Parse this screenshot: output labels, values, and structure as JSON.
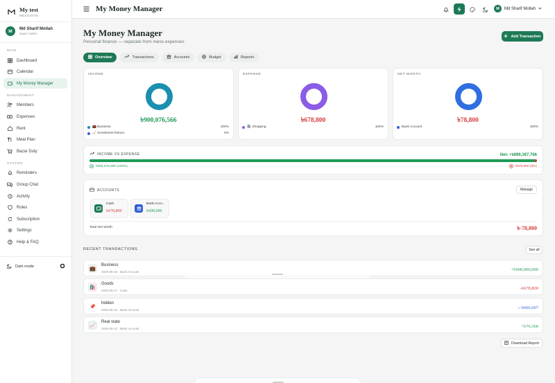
{
  "brand": {
    "name": "My test",
    "subtitle": "MESONATE"
  },
  "user": {
    "initial": "M",
    "name": "Md Sharif Mollah",
    "role": "Super Admin"
  },
  "sidebar": {
    "sections": [
      {
        "label": "MAIN",
        "items": [
          {
            "label": "Dashboard",
            "icon": "grid-icon"
          },
          {
            "label": "Calendar",
            "icon": "calendar-icon"
          },
          {
            "label": "My Money Manager",
            "icon": "wallet-icon",
            "active": true
          }
        ]
      },
      {
        "label": "MANAGEMENT",
        "items": [
          {
            "label": "Members",
            "icon": "users-icon"
          },
          {
            "label": "Expenses",
            "icon": "banknote-icon"
          },
          {
            "label": "Rent",
            "icon": "home-icon"
          },
          {
            "label": "Meal Plan",
            "icon": "utensils-icon"
          },
          {
            "label": "Bazar Duty",
            "icon": "cart-icon"
          }
        ]
      },
      {
        "label": "SYSTEM",
        "items": [
          {
            "label": "Reminders",
            "icon": "bell-icon"
          },
          {
            "label": "Group Chat",
            "icon": "chat-icon"
          },
          {
            "label": "Activity",
            "icon": "history-icon"
          },
          {
            "label": "Roles",
            "icon": "shield-icon"
          },
          {
            "label": "Subscription",
            "icon": "refresh-icon"
          },
          {
            "label": "Settings",
            "icon": "gear-icon"
          },
          {
            "label": "Help & FAQ",
            "icon": "help-icon"
          }
        ]
      }
    ],
    "dark_mode_label": "Dark mode"
  },
  "topbar": {
    "title": "My Money Manager",
    "user_name": "Md Sharif Mollah",
    "user_initial": "M"
  },
  "page": {
    "title": "My Money Manager",
    "subtitle": "Personal finance — separate from mess expenses",
    "add_button": "Add Transaction",
    "tabs": [
      {
        "label": "Overview",
        "active": true,
        "icon": "grid-icon"
      },
      {
        "label": "Transactions",
        "icon": "arrows-icon"
      },
      {
        "label": "Accounts",
        "icon": "bank-icon"
      },
      {
        "label": "Budget",
        "icon": "target-icon"
      },
      {
        "label": "Reports",
        "icon": "bar-chart-icon"
      }
    ]
  },
  "summary": {
    "income": {
      "label": "INCOME",
      "amount": "৳900,076,566",
      "color": "#1a8fb0",
      "legend": [
        {
          "label": "💼 Business",
          "pct": "100%",
          "color": "#1a8fb0"
        },
        {
          "label": "📈 Investment Return",
          "pct": "0%",
          "color": "#2f5fd6"
        }
      ]
    },
    "expense": {
      "label": "EXPENSE",
      "amount": "৳678,800",
      "color": "#8b5ce6",
      "legend": [
        {
          "label": "🛍️ Shopping",
          "pct": "100%",
          "color": "#8b5ce6"
        }
      ]
    },
    "net_worth": {
      "label": "NET WORTH",
      "amount": "৳78,800",
      "color": "#2f6fe0",
      "legend": [
        {
          "label": "Bank Account",
          "pct": "100%",
          "color": "#2f5fd6"
        }
      ]
    }
  },
  "income_vs_expense": {
    "title": "INCOME VS EXPENSE",
    "net": "Net: +৳899,397,766",
    "income_text": "৳900,076,566 (100%)",
    "expense_text": "৳678,800 (0%)",
    "income_share": 1.0
  },
  "accounts": {
    "title": "ACCOUNTS",
    "manage_label": "Manage",
    "items": [
      {
        "name": "Cash",
        "amount": "৳678,800",
        "amount_color": "#d63b3b",
        "icon_bg": "#1e7a56",
        "icon": "wallet-icon"
      },
      {
        "name": "Bank Acco...",
        "amount": "৳600,000",
        "amount_color": "#1e9a56",
        "icon_bg": "#2f5fd6",
        "icon": "bank-icon"
      }
    ],
    "total_label": "Total Net Worth",
    "total_value": "৳-78,800"
  },
  "recent": {
    "title": "RECENT TRANSACTIONS",
    "see_all": "See all",
    "items": [
      {
        "name": "Business",
        "meta": "2026-05-18 · Bank Account",
        "amount": "+৳900,000,000",
        "amount_color": "#1e9a56",
        "emoji": "💼",
        "icon_bg": "#eef1ef"
      },
      {
        "name": "Goods",
        "meta": "2026-05-17 · Cash",
        "amount": "-৳678,800",
        "amount_color": "#d63b3b",
        "emoji": "🛍️",
        "icon_bg": "#fbe6f0"
      },
      {
        "name": "hidden",
        "meta": "2026-05-18 · Bank Account",
        "amount": "↔৳666,667",
        "amount_color": "#2f5fd6",
        "emoji": "📌",
        "icon_bg": "#ffffff"
      },
      {
        "name": "Real state",
        "meta": "2026-05-13 · Bank Account",
        "amount": "+৳76,566",
        "amount_color": "#1e9a56",
        "emoji": "📈",
        "icon_bg": "#e6f2ec"
      }
    ]
  },
  "download_label": "Download Report"
}
